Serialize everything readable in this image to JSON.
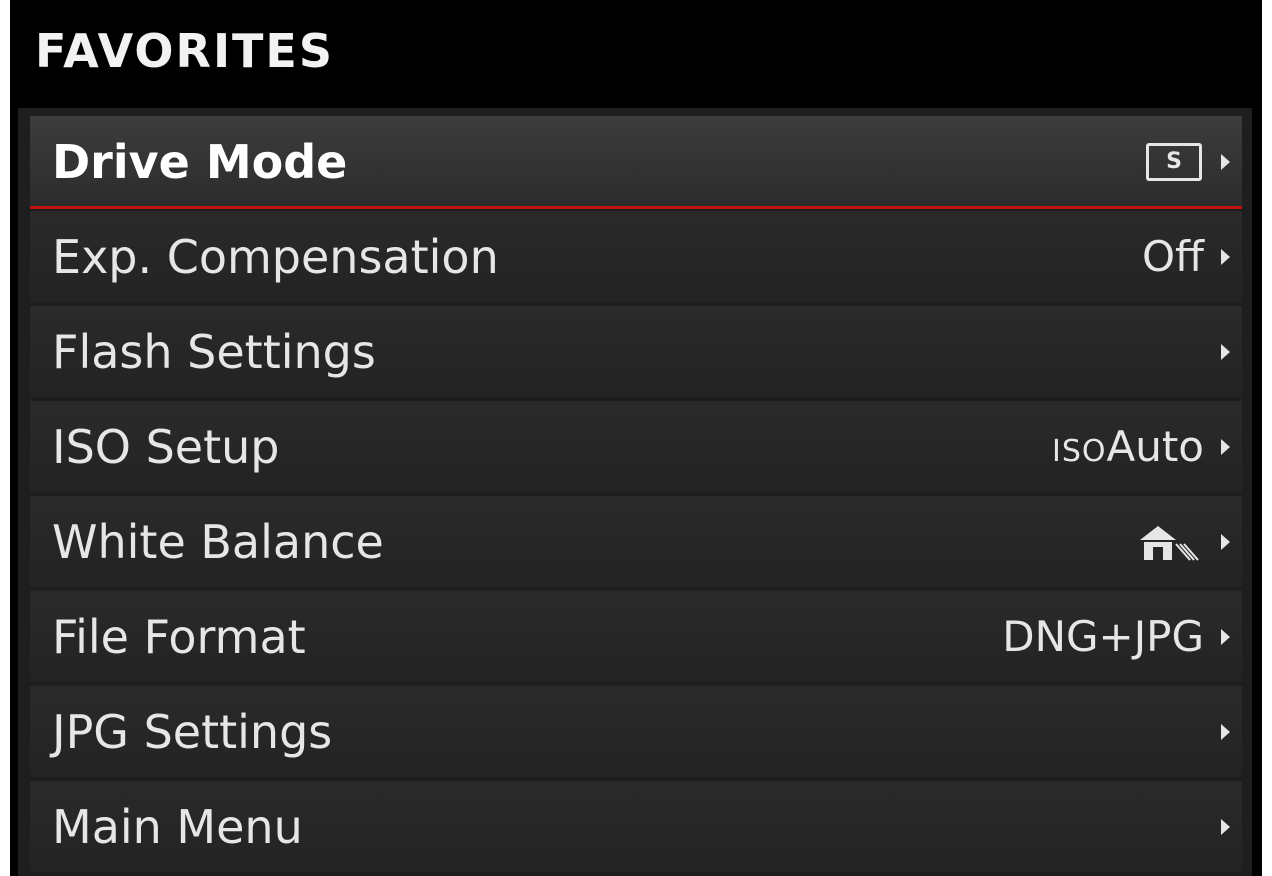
{
  "header": {
    "title": "FAVORITES"
  },
  "menu": {
    "items": [
      {
        "label": "Drive Mode",
        "value": "",
        "icon": "single-shot-icon",
        "icon_text": "S",
        "selected": true
      },
      {
        "label": "Exp. Compensation",
        "value": "Off",
        "selected": false
      },
      {
        "label": "Flash Settings",
        "value": "",
        "selected": false
      },
      {
        "label": "ISO Setup",
        "value_prefix": "ISO",
        "value": "Auto",
        "selected": false
      },
      {
        "label": "White Balance",
        "value": "",
        "icon": "shade-white-balance-icon",
        "selected": false
      },
      {
        "label": "File Format",
        "value": "DNG+JPG",
        "selected": false
      },
      {
        "label": "JPG Settings",
        "value": "",
        "selected": false
      },
      {
        "label": "Main Menu",
        "value": "",
        "selected": false
      }
    ]
  },
  "colors": {
    "background": "#000000",
    "panel": "#1e1e1e",
    "row": "#2a2a2a",
    "selected_row": "#3c3c3c",
    "accent": "#c41212",
    "text": "#e6e6e6"
  }
}
